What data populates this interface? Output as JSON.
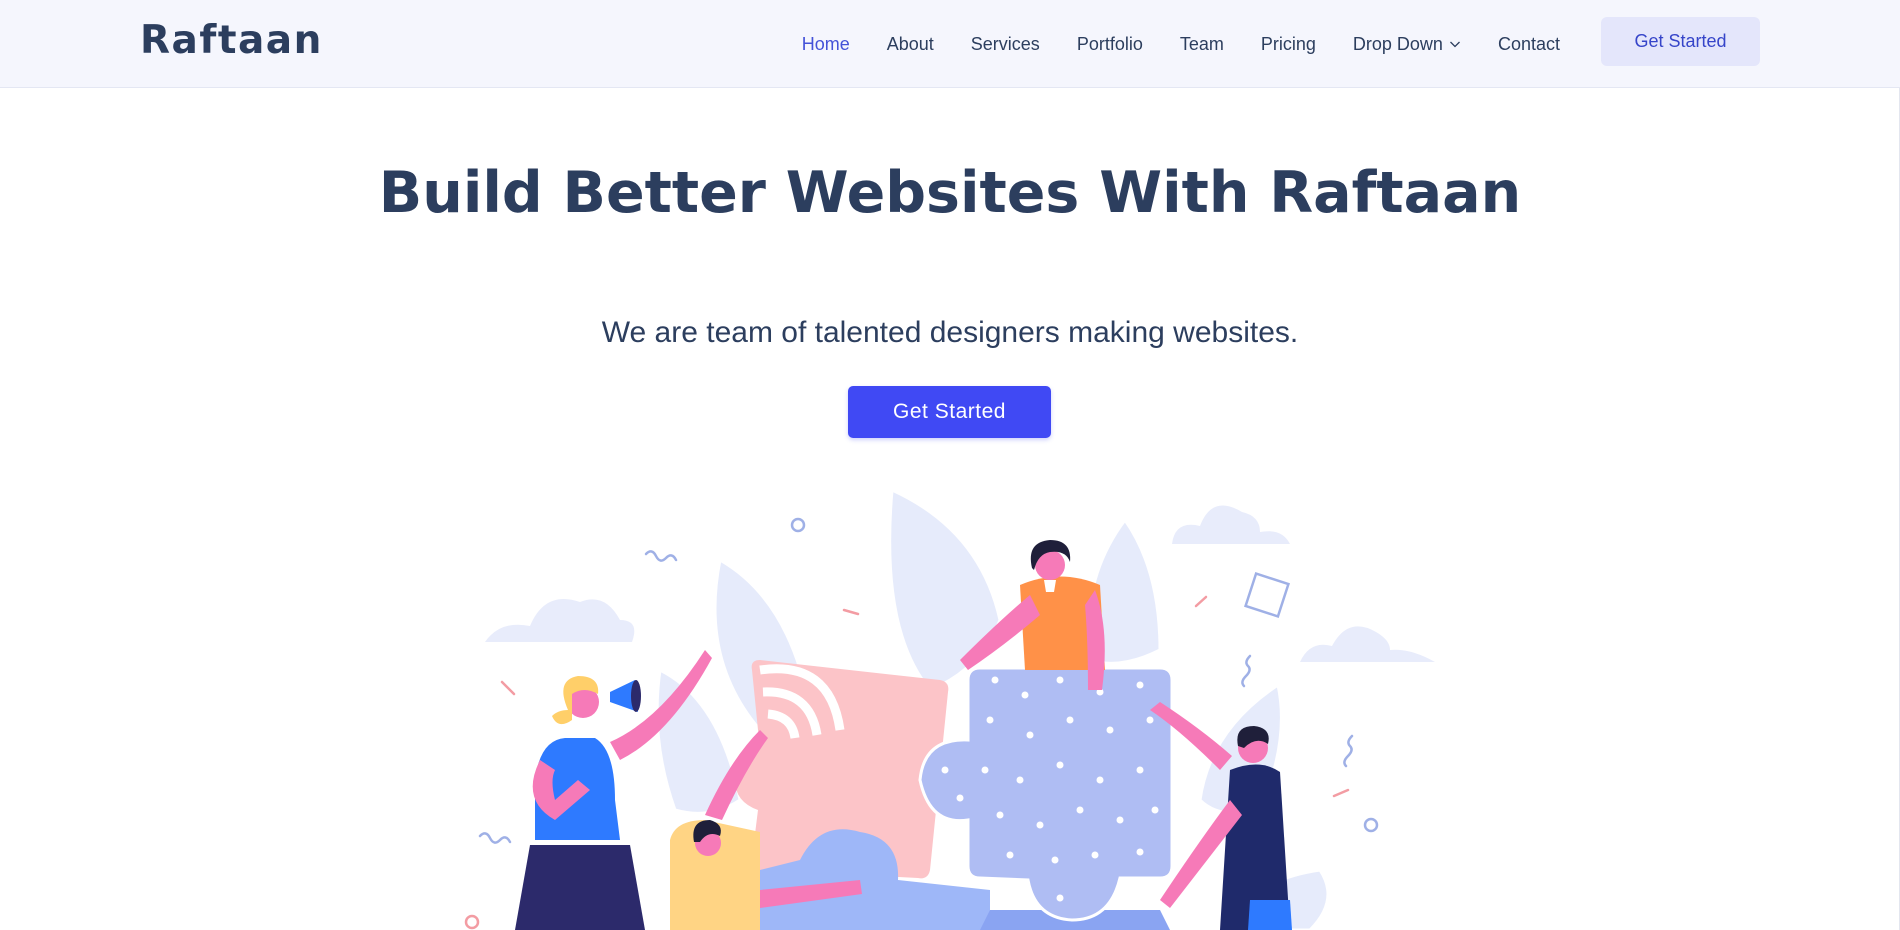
{
  "brand": {
    "logo_text": "Raftaan"
  },
  "nav": {
    "items": [
      {
        "label": "Home",
        "active": true
      },
      {
        "label": "About"
      },
      {
        "label": "Services"
      },
      {
        "label": "Portfolio"
      },
      {
        "label": "Team"
      },
      {
        "label": "Pricing"
      },
      {
        "label": "Drop Down",
        "icon": "chevron-down-icon"
      },
      {
        "label": "Contact"
      }
    ],
    "cta_label": "Get Started"
  },
  "hero": {
    "title": "Build Better Websites With Raftaan",
    "subtitle": "We are team of talented designers making websites.",
    "cta_label": "Get Started"
  },
  "colors": {
    "text": "#2c3e5e",
    "accent": "#4049f4",
    "nav_active": "#4452d8",
    "header_bg": "#f5f6fd",
    "nav_cta_bg": "#e4e6fb"
  }
}
